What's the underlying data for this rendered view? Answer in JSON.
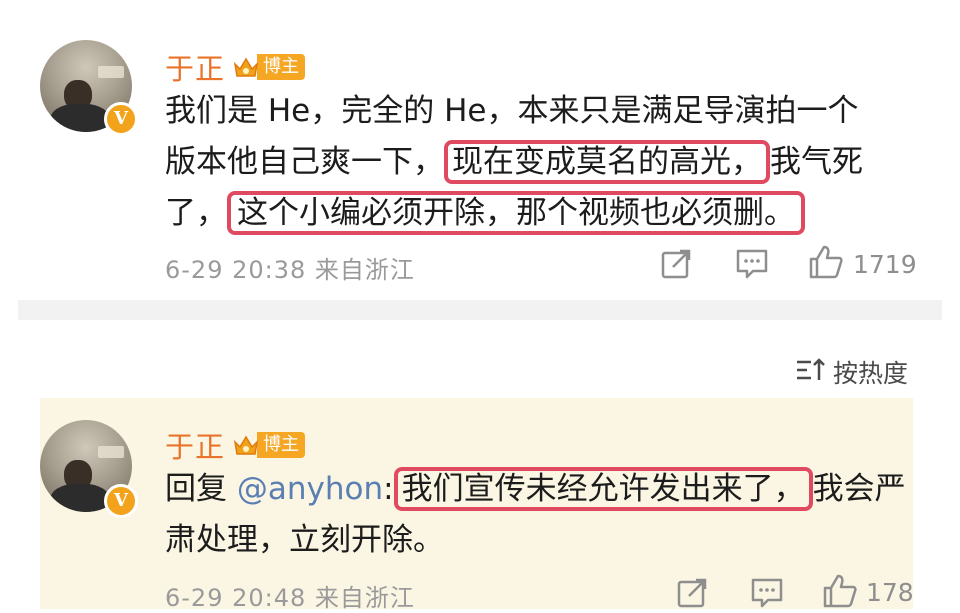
{
  "comment1": {
    "author": "于正",
    "badge": "博主",
    "text_line1": "我们是 He，完全的 He，本来只是满足导演拍一个",
    "text_line2_a": "版本他自己爽一下，",
    "text_line2_hl": "现在变成莫名的高光，",
    "text_line2_b": "我气死",
    "text_line3_a": "了，",
    "text_line3_hl": "这个小编必须开除，那个视频也必须删。",
    "timestamp": "6-29 20:38 来自浙江",
    "likes": "1719"
  },
  "sort": {
    "label": "按热度"
  },
  "comment2": {
    "author": "于正",
    "badge": "博主",
    "reply_prefix": "回复 ",
    "mention": "@anyhon",
    "colon": ":",
    "text_hl": "我们宣传未经允许发出来了，",
    "text_line1_b": "我会严",
    "text_line2": "肃处理，立刻开除。",
    "timestamp": "6-29 20:48 来自浙江",
    "likes": "178"
  },
  "colors": {
    "name": "#e8742c",
    "highlight_border": "#e04a60",
    "mention": "#5b7fb3",
    "reply_background": "#fbf6e4",
    "verified_badge": "#f3a31b"
  },
  "icons": [
    "share-icon",
    "comment-icon",
    "like-icon",
    "sort-icon",
    "crown-icon",
    "verified-icon"
  ]
}
